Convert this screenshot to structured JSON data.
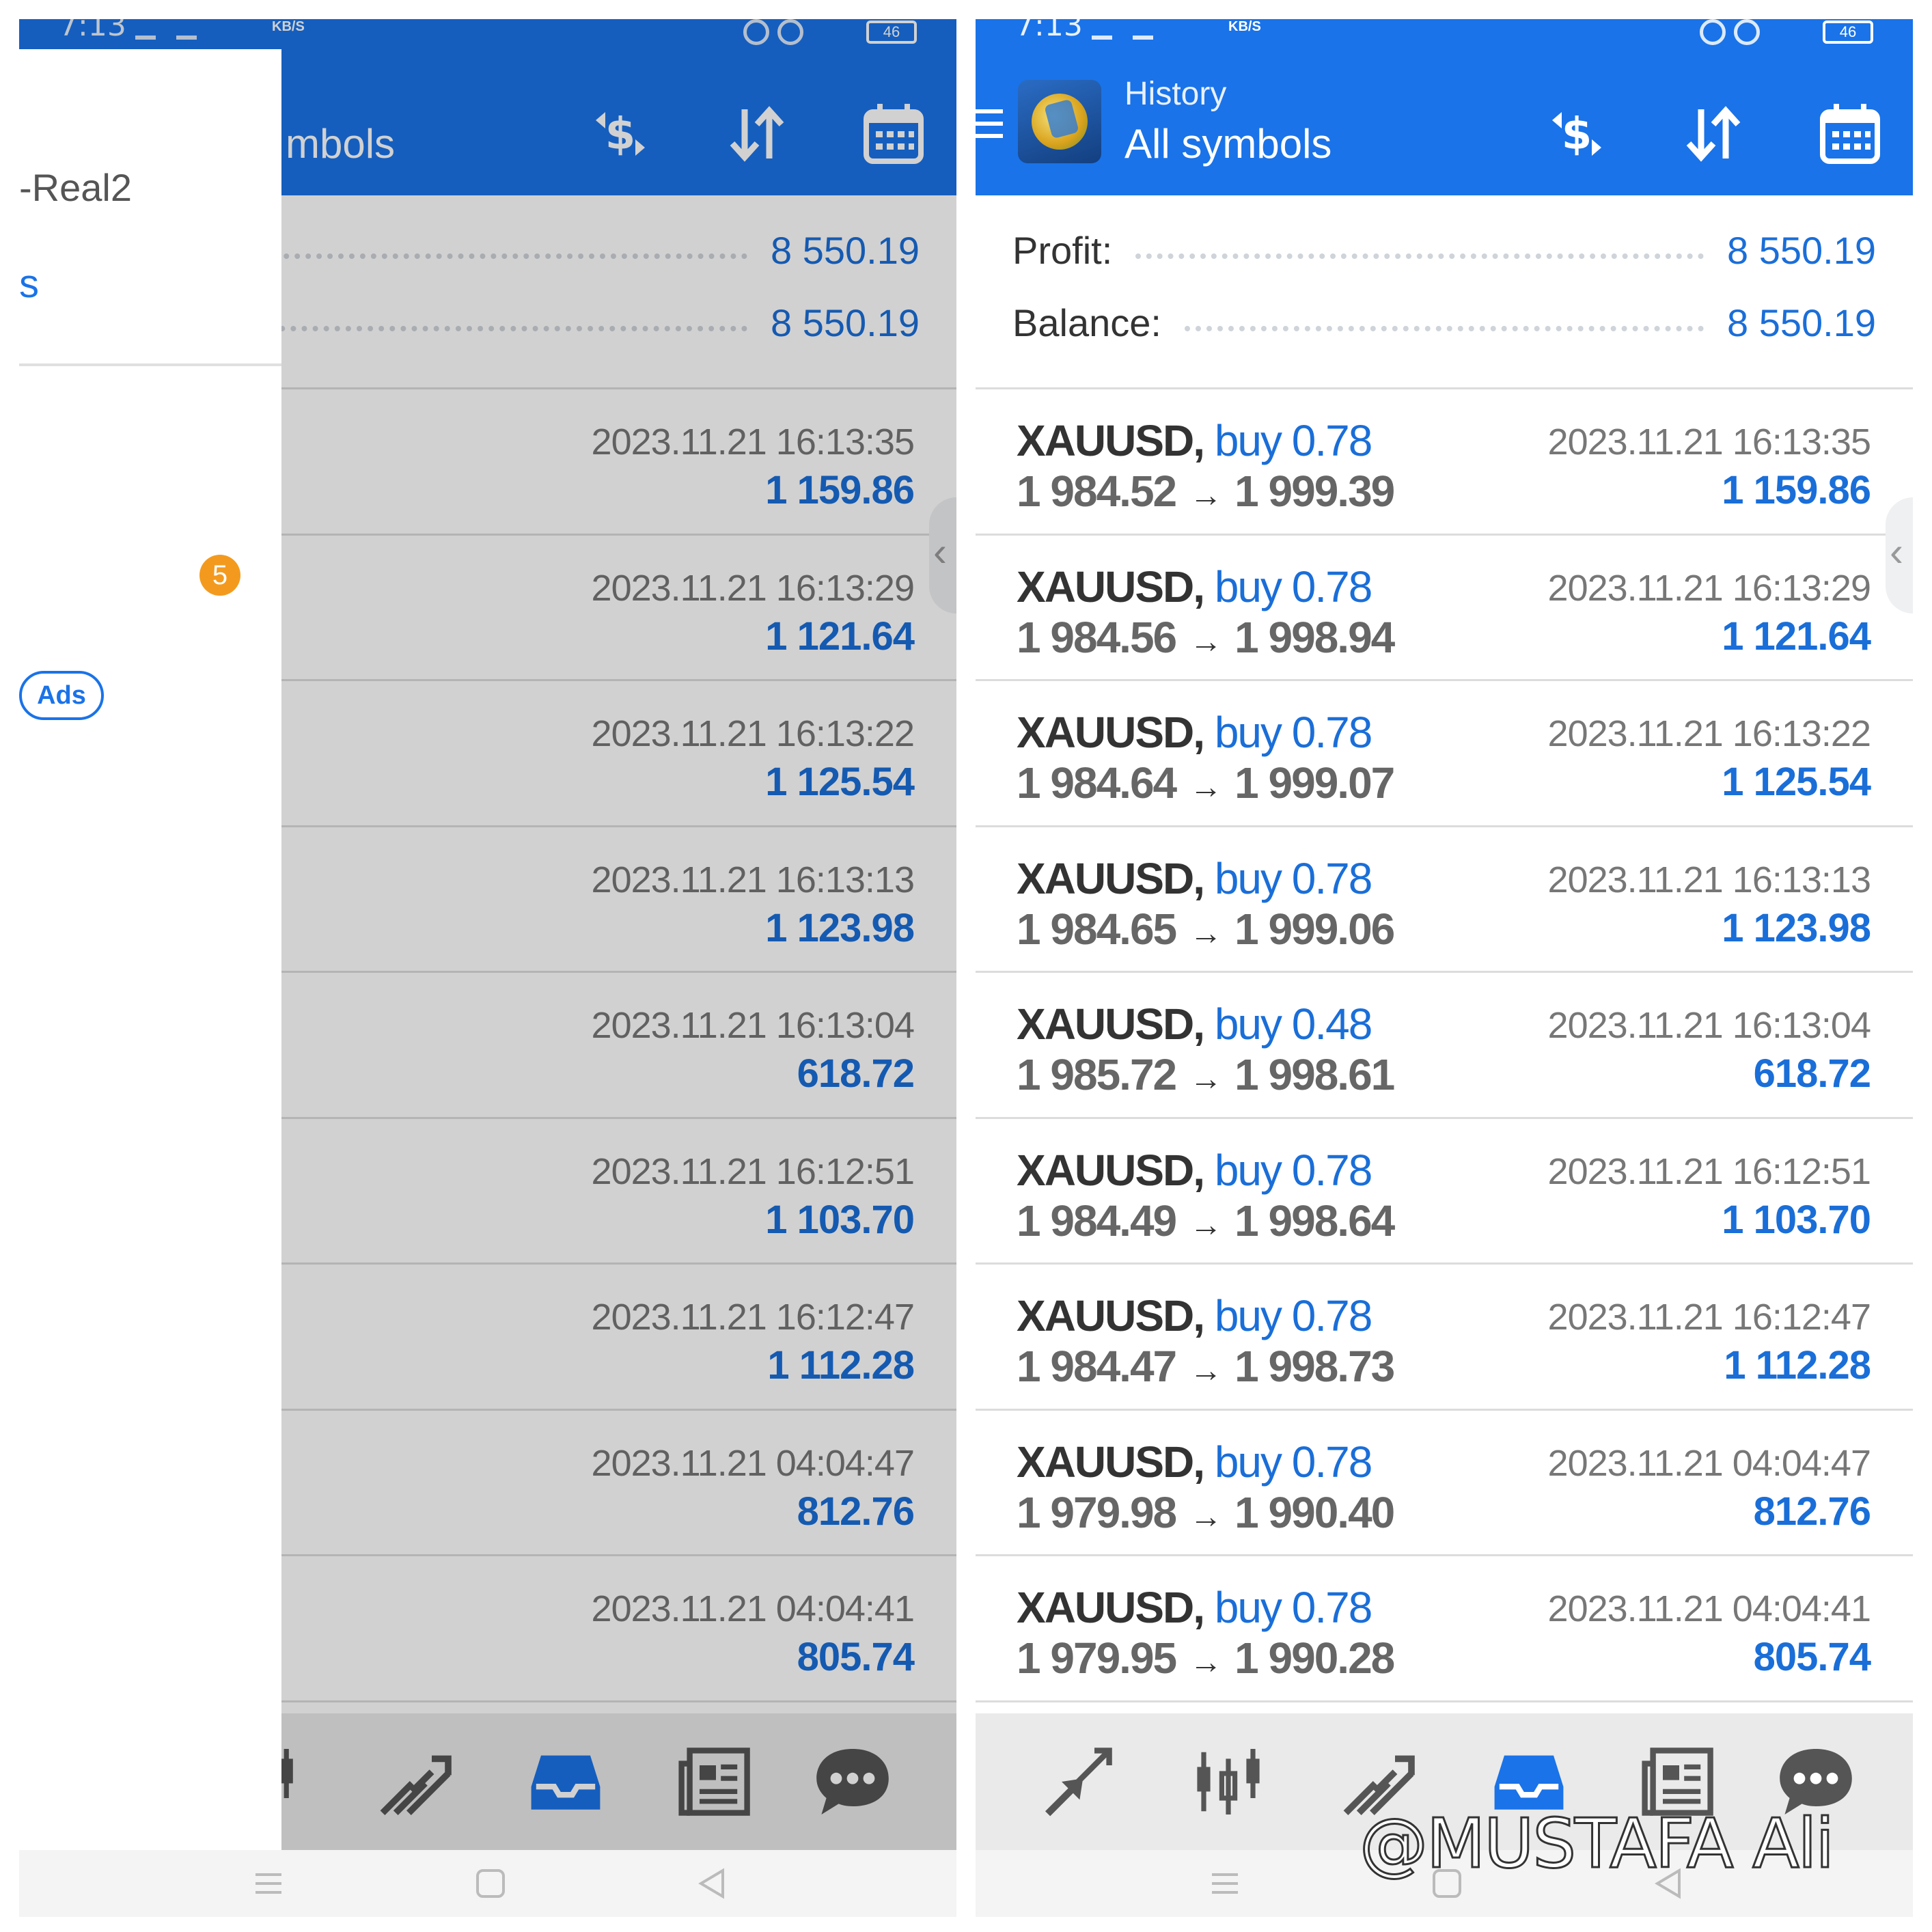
{
  "status_bar": {
    "time": "7:13",
    "net_speed": "KB/S",
    "battery": "46"
  },
  "toolbar": {
    "title": "History",
    "subtitle": "All symbols",
    "subtitle_partial": "mbols"
  },
  "summary": {
    "profit_label": "Profit:",
    "profit_value": "8 550.19",
    "balance_label": "Balance:",
    "balance_value": "8 550.19"
  },
  "trades": [
    {
      "symbol": "XAUUSD,",
      "side": "buy",
      "lots": "0.78",
      "open": "1 984.52",
      "close": "1 999.39",
      "time": "2023.11.21 16:13:35",
      "profit": "1 159.86"
    },
    {
      "symbol": "XAUUSD,",
      "side": "buy",
      "lots": "0.78",
      "open": "1 984.56",
      "close": "1 998.94",
      "time": "2023.11.21 16:13:29",
      "profit": "1 121.64"
    },
    {
      "symbol": "XAUUSD,",
      "side": "buy",
      "lots": "0.78",
      "open": "1 984.64",
      "close": "1 999.07",
      "time": "2023.11.21 16:13:22",
      "profit": "1 125.54"
    },
    {
      "symbol": "XAUUSD,",
      "side": "buy",
      "lots": "0.78",
      "open": "1 984.65",
      "close": "1 999.06",
      "time": "2023.11.21 16:13:13",
      "profit": "1 123.98"
    },
    {
      "symbol": "XAUUSD,",
      "side": "buy",
      "lots": "0.48",
      "open": "1 985.72",
      "close": "1 998.61",
      "time": "2023.11.21 16:13:04",
      "profit": "618.72"
    },
    {
      "symbol": "XAUUSD,",
      "side": "buy",
      "lots": "0.78",
      "open": "1 984.49",
      "close": "1 998.64",
      "time": "2023.11.21 16:12:51",
      "profit": "1 103.70"
    },
    {
      "symbol": "XAUUSD,",
      "side": "buy",
      "lots": "0.78",
      "open": "1 984.47",
      "close": "1 998.73",
      "time": "2023.11.21 16:12:47",
      "profit": "1 112.28"
    },
    {
      "symbol": "XAUUSD,",
      "side": "buy",
      "lots": "0.78",
      "open": "1 979.98",
      "close": "1 990.40",
      "time": "2023.11.21 04:04:47",
      "profit": "812.76"
    },
    {
      "symbol": "XAUUSD,",
      "side": "buy",
      "lots": "0.78",
      "open": "1 979.95",
      "close": "1 990.28",
      "time": "2023.11.21 04:04:41",
      "profit": "805.74"
    }
  ],
  "drawer": {
    "account": "-Real2",
    "item_partial": "s",
    "badge": "5",
    "ads_label": "Ads"
  },
  "toolbar_icons": [
    "currency-exchange-icon",
    "sort-icon",
    "calendar-icon"
  ],
  "bottom_nav_icons": [
    "quotes-icon",
    "chart-icon",
    "trade-icon",
    "history-icon",
    "news-icon",
    "chat-icon"
  ],
  "watermark": "@MUSTAFA Ali",
  "colors": {
    "accent": "#1a73e8",
    "value_blue": "#1a6ed8",
    "badge_orange": "#f39a1e"
  }
}
